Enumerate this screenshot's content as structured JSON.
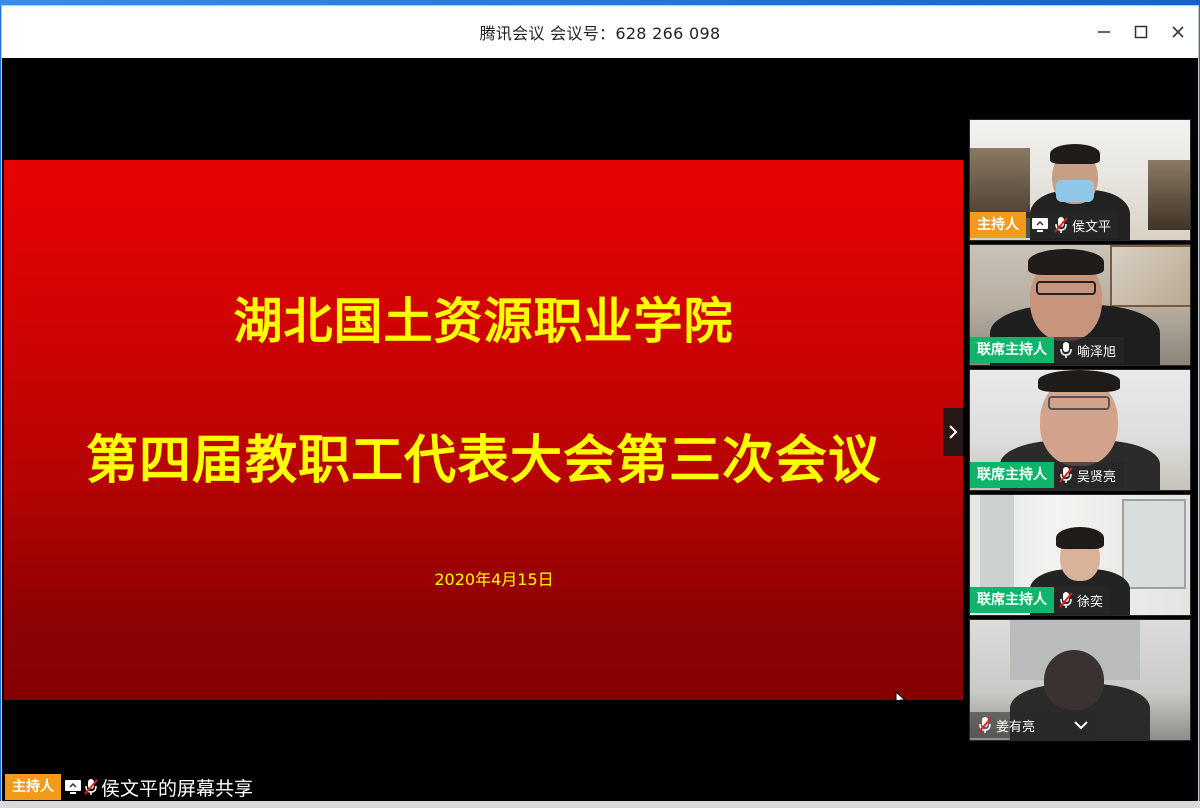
{
  "window": {
    "title": "腾讯会议 会议号：628 266 098"
  },
  "slide": {
    "title_line1": "湖北国土资源职业学院",
    "title_line2": "第四届教职工代表大会第三次会议",
    "date": "2020年4月15日",
    "background_color": "#d10303",
    "text_color": "#ffff00"
  },
  "participants": [
    {
      "role": "主持人",
      "name": "侯文平",
      "role_color": "#f29b1a",
      "mic": "muted",
      "sharing": true
    },
    {
      "role": "联席主持人",
      "name": "喻泽旭",
      "role_color": "#0fb56a",
      "mic": "on",
      "sharing": false
    },
    {
      "role": "联席主持人",
      "name": "吴贤亮",
      "role_color": "#0fb56a",
      "mic": "muted",
      "sharing": false
    },
    {
      "role": "联席主持人",
      "name": "徐奕",
      "role_color": "#0fb56a",
      "mic": "muted",
      "sharing": false
    },
    {
      "role": "",
      "name": "姜有亮",
      "role_color": "",
      "mic": "muted",
      "sharing": false
    }
  ],
  "share_status": {
    "role": "主持人",
    "text": "侯文平的屏幕共享"
  },
  "icons": {
    "minimize": "minimize-icon",
    "maximize": "maximize-icon",
    "close": "close-icon",
    "next_page": "chevron-right-icon",
    "more_participants": "chevron-down-icon"
  }
}
